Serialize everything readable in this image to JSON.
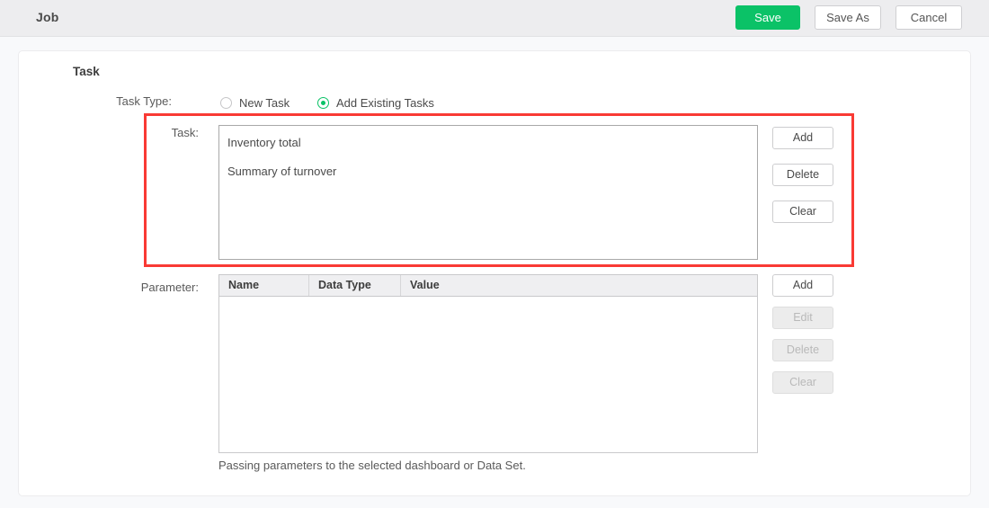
{
  "header": {
    "title": "Job",
    "save_label": "Save",
    "save_as_label": "Save As",
    "cancel_label": "Cancel",
    "accent_color": "#0bc267"
  },
  "section": {
    "title": "Task"
  },
  "task_type": {
    "label": "Task Type:",
    "options": [
      {
        "label": "New Task",
        "selected": false
      },
      {
        "label": "Add Existing Tasks",
        "selected": true
      }
    ]
  },
  "task_list": {
    "label": "Task:",
    "items": [
      {
        "name": "Inventory total"
      },
      {
        "name": "Summary of turnover"
      }
    ],
    "buttons": [
      {
        "label": "Add",
        "enabled": true
      },
      {
        "label": "Delete",
        "enabled": true
      },
      {
        "label": "Clear",
        "enabled": true
      }
    ]
  },
  "parameter": {
    "label": "Parameter:",
    "columns": [
      "Name",
      "Data Type",
      "Value"
    ],
    "rows": [],
    "hint": "Passing parameters to the selected dashboard or Data Set.",
    "buttons": [
      {
        "label": "Add",
        "enabled": true
      },
      {
        "label": "Edit",
        "enabled": false
      },
      {
        "label": "Delete",
        "enabled": false
      },
      {
        "label": "Clear",
        "enabled": false
      }
    ]
  },
  "highlight": {
    "color": "#f93a34"
  }
}
